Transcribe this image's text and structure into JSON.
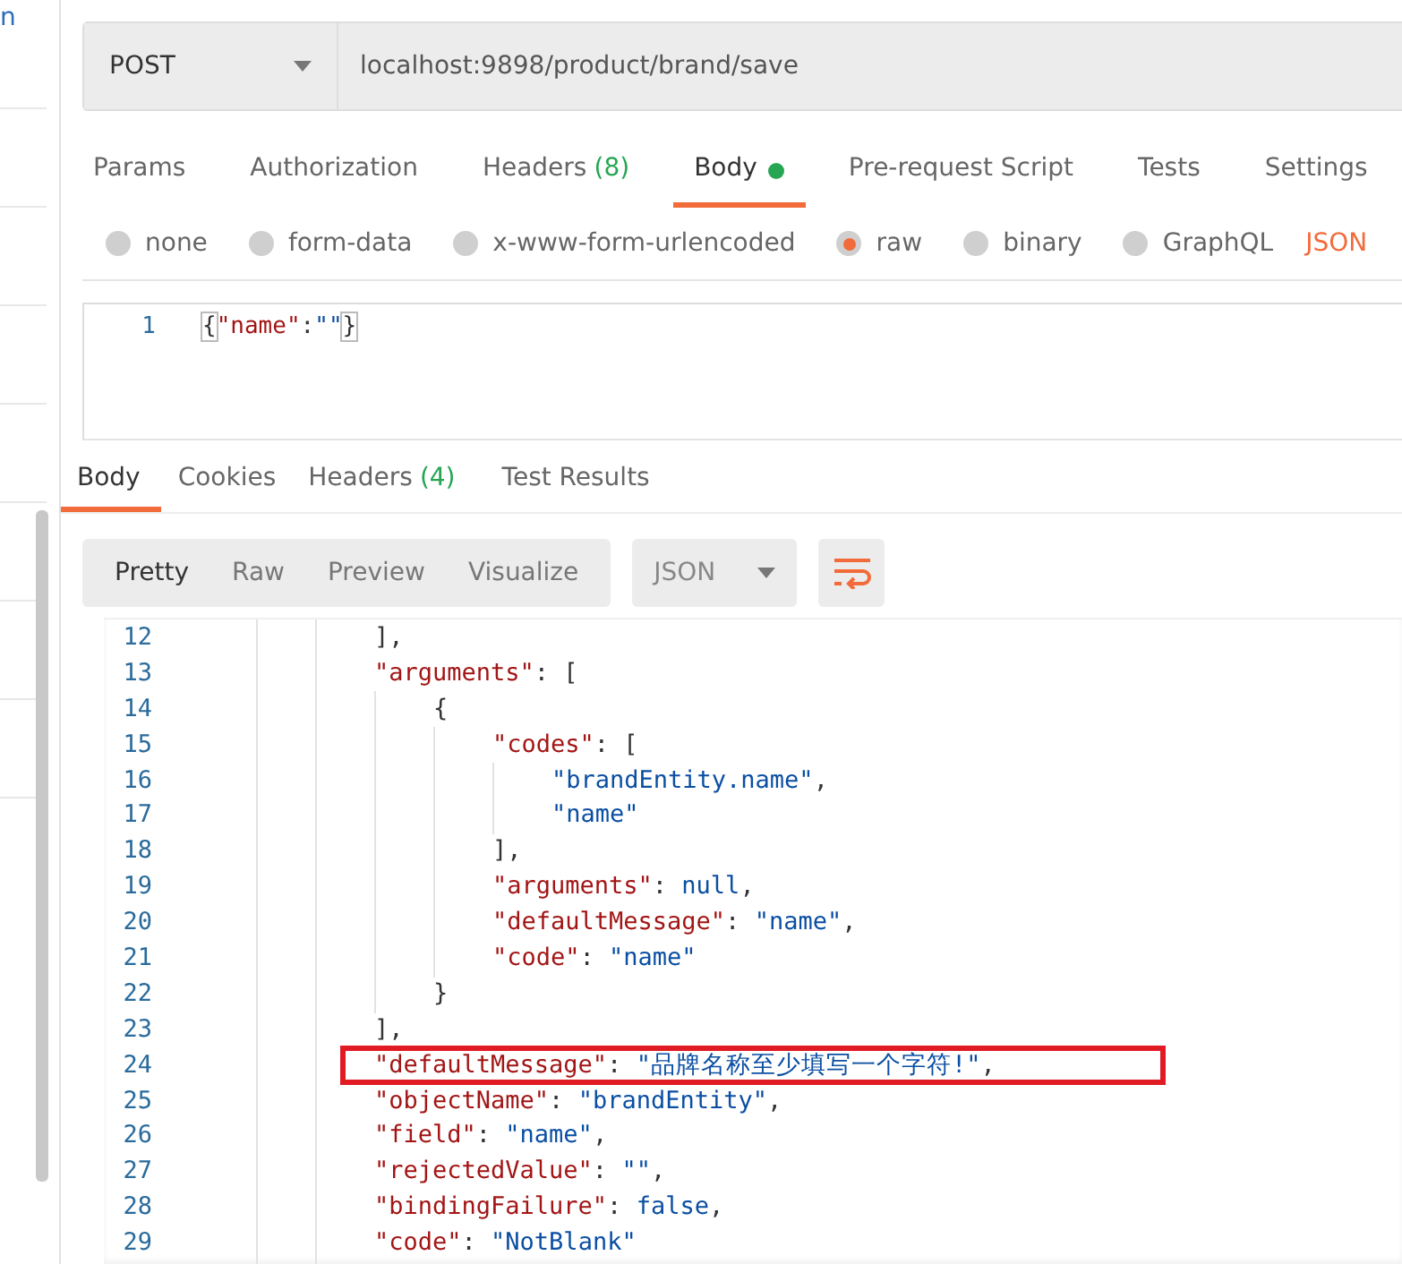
{
  "sidebar": {
    "text": "n"
  },
  "request": {
    "method": "POST",
    "url": "localhost:9898/product/brand/save"
  },
  "request_tabs": [
    {
      "label": "Params",
      "has_content": false,
      "selected": false
    },
    {
      "label": "Authorization",
      "has_content": false,
      "selected": false
    },
    {
      "label": "Headers",
      "count": "(8)",
      "has_content": false,
      "selected": false
    },
    {
      "label": "Body",
      "has_content": true,
      "selected": true
    },
    {
      "label": "Pre-request Script",
      "has_content": false,
      "selected": false
    },
    {
      "label": "Tests",
      "has_content": false,
      "selected": false
    },
    {
      "label": "Settings",
      "has_content": false,
      "selected": false
    }
  ],
  "body_types": [
    {
      "label": "none",
      "selected": false
    },
    {
      "label": "form-data",
      "selected": false
    },
    {
      "label": "x-www-form-urlencoded",
      "selected": false
    },
    {
      "label": "raw",
      "selected": true
    },
    {
      "label": "binary",
      "selected": false
    },
    {
      "label": "GraphQL",
      "selected": false
    }
  ],
  "raw_format": "JSON",
  "request_body": [
    {
      "number": "1",
      "tokens": [
        {
          "kind": "brace",
          "text": "{"
        },
        {
          "kind": "key",
          "text": "\"name\""
        },
        {
          "kind": "punct",
          "text": ":"
        },
        {
          "kind": "str",
          "text": "\"\""
        },
        {
          "kind": "brace",
          "text": "}"
        }
      ]
    }
  ],
  "response_tabs": [
    {
      "label": "Body",
      "selected": true
    },
    {
      "label": "Cookies",
      "selected": false
    },
    {
      "label": "Headers",
      "count": "(4)",
      "selected": false
    },
    {
      "label": "Test Results",
      "selected": false
    }
  ],
  "view_modes": [
    {
      "label": "Pretty",
      "selected": true
    },
    {
      "label": "Raw",
      "selected": false
    },
    {
      "label": "Preview",
      "selected": false
    },
    {
      "label": "Visualize",
      "selected": false
    }
  ],
  "response_format": "JSON",
  "wrap_lines": {
    "on": true
  },
  "response_lines": [
    {
      "number": "12",
      "highlighted": false,
      "tokens": [
        {
          "kind": "punct",
          "text": "],"
        }
      ]
    },
    {
      "number": "13",
      "highlighted": false,
      "tokens": [
        {
          "kind": "key",
          "text": "\"arguments\""
        },
        {
          "kind": "punct",
          "text": ": ["
        }
      ]
    },
    {
      "number": "14",
      "highlighted": false,
      "tokens": [
        {
          "kind": "punct",
          "text": "{"
        }
      ]
    },
    {
      "number": "15",
      "highlighted": false,
      "tokens": [
        {
          "kind": "key",
          "text": "\"codes\""
        },
        {
          "kind": "punct",
          "text": ": ["
        }
      ]
    },
    {
      "number": "16",
      "highlighted": false,
      "tokens": [
        {
          "kind": "str",
          "text": "\"brandEntity.name\""
        },
        {
          "kind": "punct",
          "text": ","
        }
      ]
    },
    {
      "number": "17",
      "highlighted": false,
      "tokens": [
        {
          "kind": "str",
          "text": "\"name\""
        }
      ]
    },
    {
      "number": "18",
      "highlighted": false,
      "tokens": [
        {
          "kind": "punct",
          "text": "],"
        }
      ]
    },
    {
      "number": "19",
      "highlighted": false,
      "tokens": [
        {
          "kind": "key",
          "text": "\"arguments\""
        },
        {
          "kind": "punct",
          "text": ": "
        },
        {
          "kind": "lit",
          "text": "null"
        },
        {
          "kind": "punct",
          "text": ","
        }
      ]
    },
    {
      "number": "20",
      "highlighted": false,
      "tokens": [
        {
          "kind": "key",
          "text": "\"defaultMessage\""
        },
        {
          "kind": "punct",
          "text": ": "
        },
        {
          "kind": "str",
          "text": "\"name\""
        },
        {
          "kind": "punct",
          "text": ","
        }
      ]
    },
    {
      "number": "21",
      "highlighted": false,
      "tokens": [
        {
          "kind": "key",
          "text": "\"code\""
        },
        {
          "kind": "punct",
          "text": ": "
        },
        {
          "kind": "str",
          "text": "\"name\""
        }
      ]
    },
    {
      "number": "22",
      "highlighted": false,
      "tokens": [
        {
          "kind": "punct",
          "text": "}"
        }
      ]
    },
    {
      "number": "23",
      "highlighted": false,
      "tokens": [
        {
          "kind": "punct",
          "text": "],"
        }
      ]
    },
    {
      "number": "24",
      "highlighted": true,
      "tokens": [
        {
          "kind": "key",
          "text": "\"defaultMessage\""
        },
        {
          "kind": "punct",
          "text": ": "
        },
        {
          "kind": "str",
          "text": "\"品牌名称至少填写一个字符!\""
        },
        {
          "kind": "punct",
          "text": ","
        }
      ]
    },
    {
      "number": "25",
      "highlighted": false,
      "tokens": [
        {
          "kind": "key",
          "text": "\"objectName\""
        },
        {
          "kind": "punct",
          "text": ": "
        },
        {
          "kind": "str",
          "text": "\"brandEntity\""
        },
        {
          "kind": "punct",
          "text": ","
        }
      ]
    },
    {
      "number": "26",
      "highlighted": false,
      "tokens": [
        {
          "kind": "key",
          "text": "\"field\""
        },
        {
          "kind": "punct",
          "text": ": "
        },
        {
          "kind": "str",
          "text": "\"name\""
        },
        {
          "kind": "punct",
          "text": ","
        }
      ]
    },
    {
      "number": "27",
      "highlighted": false,
      "tokens": [
        {
          "kind": "key",
          "text": "\"rejectedValue\""
        },
        {
          "kind": "punct",
          "text": ": "
        },
        {
          "kind": "str",
          "text": "\"\""
        },
        {
          "kind": "punct",
          "text": ","
        }
      ]
    },
    {
      "number": "28",
      "highlighted": false,
      "tokens": [
        {
          "kind": "key",
          "text": "\"bindingFailure\""
        },
        {
          "kind": "punct",
          "text": ": "
        },
        {
          "kind": "lit",
          "text": "false"
        },
        {
          "kind": "punct",
          "text": ","
        }
      ]
    },
    {
      "number": "29",
      "highlighted": false,
      "tokens": [
        {
          "kind": "key",
          "text": "\"code\""
        },
        {
          "kind": "punct",
          "text": ": "
        },
        {
          "kind": "str",
          "text": "\"NotBlank\""
        }
      ]
    }
  ]
}
